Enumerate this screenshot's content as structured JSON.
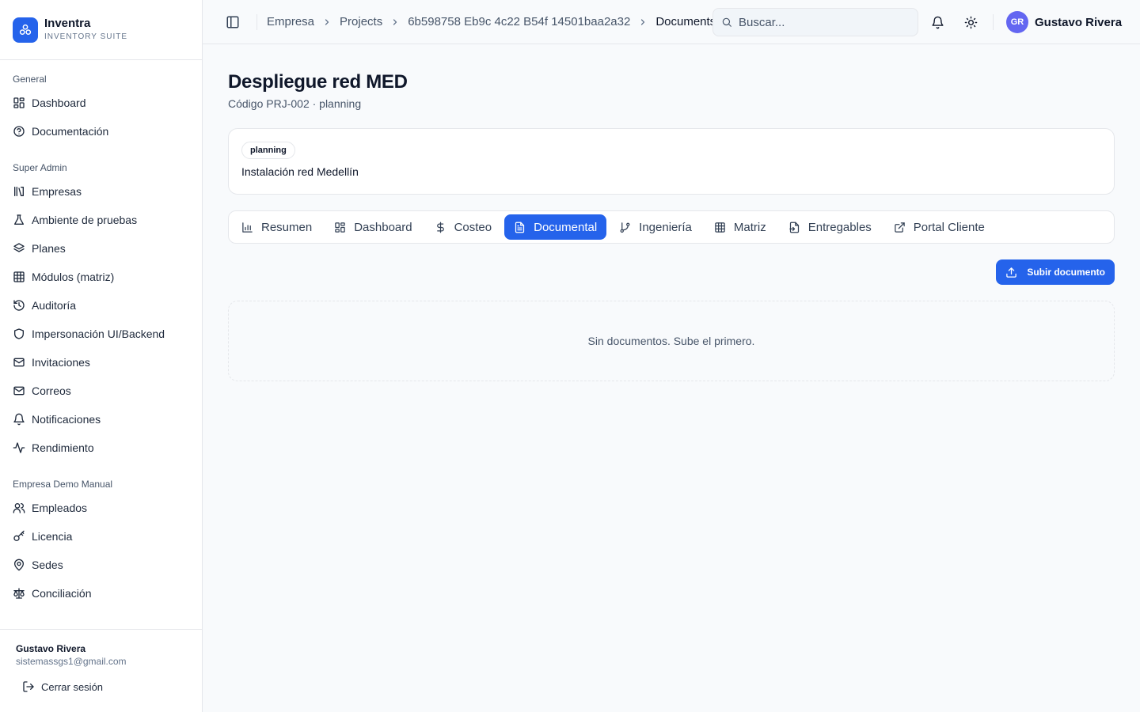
{
  "brand": {
    "name": "Inventra",
    "subtitle": "INVENTORY SUITE",
    "accent": "#2563eb",
    "icon": "cube-network-icon"
  },
  "sidebar": {
    "sections": [
      {
        "title": "General",
        "items": [
          {
            "label": "Dashboard",
            "icon": "grid-icon"
          },
          {
            "label": "Documentación",
            "icon": "help-circle-icon"
          }
        ]
      },
      {
        "title": "Super Admin",
        "items": [
          {
            "label": "Empresas",
            "icon": "library-icon"
          },
          {
            "label": "Ambiente de pruebas",
            "icon": "flask-icon"
          },
          {
            "label": "Planes",
            "icon": "layers-icon"
          },
          {
            "label": "Módulos (matriz)",
            "icon": "table-icon"
          },
          {
            "label": "Auditoría",
            "icon": "history-icon"
          },
          {
            "label": "Impersonación UI/Backend",
            "icon": "shield-icon"
          },
          {
            "label": "Invitaciones",
            "icon": "mail-icon"
          },
          {
            "label": "Correos",
            "icon": "mail-icon"
          },
          {
            "label": "Notificaciones",
            "icon": "bell-icon"
          },
          {
            "label": "Rendimiento",
            "icon": "activity-icon"
          }
        ]
      },
      {
        "title": "Empresa Demo Manual",
        "items": [
          {
            "label": "Empleados",
            "icon": "users-icon"
          },
          {
            "label": "Licencia",
            "icon": "key-icon"
          },
          {
            "label": "Sedes",
            "icon": "map-pin-icon"
          },
          {
            "label": "Conciliación",
            "icon": "scale-icon"
          }
        ]
      }
    ],
    "footer": {
      "user_name": "Gustavo Rivera",
      "user_email": "sistemassgs1@gmail.com",
      "logout_label": "Cerrar sesión"
    }
  },
  "header": {
    "breadcrumbs": [
      "Empresa",
      "Projects",
      "6b598758 Eb9c 4c22 B54f 14501baa2a32",
      "Documents"
    ],
    "search_placeholder": "Buscar...",
    "user_initials": "GR",
    "user_name": "Gustavo Rivera",
    "avatar_color": "#6366f1"
  },
  "project": {
    "title": "Despliegue red MED",
    "subtitle": "Código PRJ-002 · planning",
    "status_badge": "planning",
    "description": "Instalación red Medellín"
  },
  "tabs": [
    {
      "label": "Resumen",
      "icon": "bar-chart-icon",
      "active": false
    },
    {
      "label": "Dashboard",
      "icon": "grid-icon",
      "active": false
    },
    {
      "label": "Costeo",
      "icon": "dollar-icon",
      "active": false
    },
    {
      "label": "Documental",
      "icon": "file-text-icon",
      "active": true
    },
    {
      "label": "Ingeniería",
      "icon": "git-branch-icon",
      "active": false
    },
    {
      "label": "Matriz",
      "icon": "table-icon",
      "active": false
    },
    {
      "label": "Entregables",
      "icon": "file-export-icon",
      "active": false
    },
    {
      "label": "Portal Cliente",
      "icon": "external-link-icon",
      "active": false
    }
  ],
  "documents": {
    "upload_label": "Subir documento",
    "empty_message": "Sin documentos. Sube el primero."
  }
}
